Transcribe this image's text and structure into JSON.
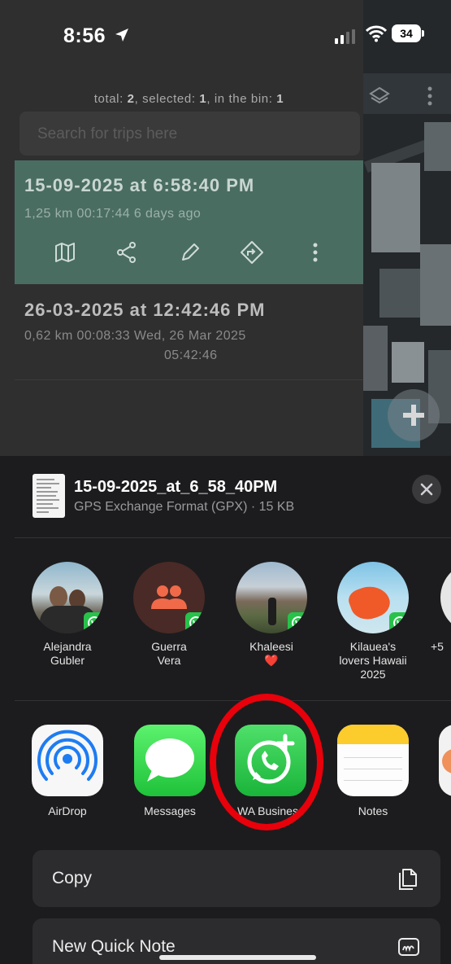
{
  "status_bar": {
    "time": "8:56",
    "battery": "34"
  },
  "list": {
    "summary_prefix": "total: ",
    "summary_total": "2",
    "summary_mid1": ", selected: ",
    "summary_selected": "1",
    "summary_mid2": ", in the bin: ",
    "summary_bin": "1",
    "search_placeholder": "Search for trips here",
    "trips": [
      {
        "title": "15-09-2025 at 6:58:40 PM",
        "meta": "1,25 km  00:17:44  6 days ago"
      },
      {
        "title": "26-03-2025 at 12:42:46 PM",
        "meta": "0,62 km  00:08:33  Wed, 26 Mar 2025",
        "meta2": "05:42:46"
      }
    ]
  },
  "share": {
    "file_name": "15-09-2025_at_6_58_40PM",
    "file_sub": "GPS Exchange Format (GPX) · 15 KB",
    "contacts": [
      {
        "name1": "Alejandra",
        "name2": "Gubler"
      },
      {
        "name1": "Guerra",
        "name2": "Vera"
      },
      {
        "name1": "Khaleesi",
        "name2": "❤️"
      },
      {
        "name1": "Kilauea's",
        "name2": "lovers Hawaii",
        "name3": "2025"
      },
      {
        "name1": "+5"
      }
    ],
    "apps": [
      "AirDrop",
      "Messages",
      "WA Business",
      "Notes"
    ],
    "actions": [
      "Copy",
      "New Quick Note"
    ]
  },
  "colors": {
    "selected_row": "#4a6d62",
    "whatsapp_green": "#27c24a",
    "highlight_ring": "#e8000b"
  }
}
